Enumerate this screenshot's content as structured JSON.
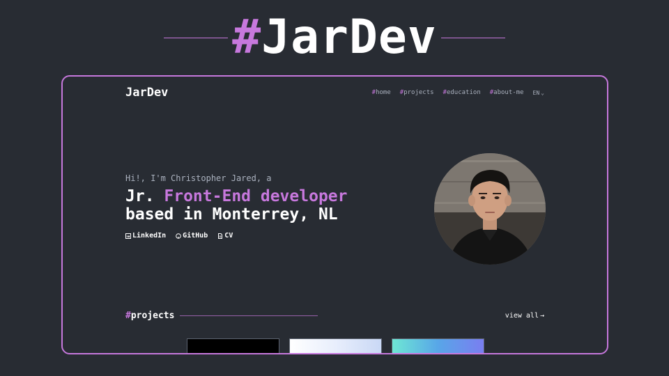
{
  "banner": {
    "hash": "#",
    "title": "JarDev"
  },
  "site": {
    "logo": "JarDev",
    "nav": [
      {
        "hash": "#",
        "label": "home"
      },
      {
        "hash": "#",
        "label": "projects"
      },
      {
        "hash": "#",
        "label": "education"
      },
      {
        "hash": "#",
        "label": "about-me"
      }
    ],
    "language": "EN"
  },
  "hero": {
    "intro": "Hi!, I'm Christopher Jared, a",
    "headline_prefix": "Jr. ",
    "headline_accent": "Front-End developer",
    "headline_line2": "based in Monterrey, NL",
    "socials": [
      {
        "icon": "linkedin-icon",
        "label": "LinkedIn"
      },
      {
        "icon": "github-icon",
        "label": "GitHub"
      },
      {
        "icon": "document-icon",
        "label": "CV"
      }
    ]
  },
  "projects": {
    "hash": "#",
    "title": "projects",
    "view_all": "view all",
    "arrow": "→"
  },
  "colors": {
    "background": "#282c33",
    "accent": "#c778dd",
    "text": "#ffffff",
    "muted": "#abb2bf"
  }
}
